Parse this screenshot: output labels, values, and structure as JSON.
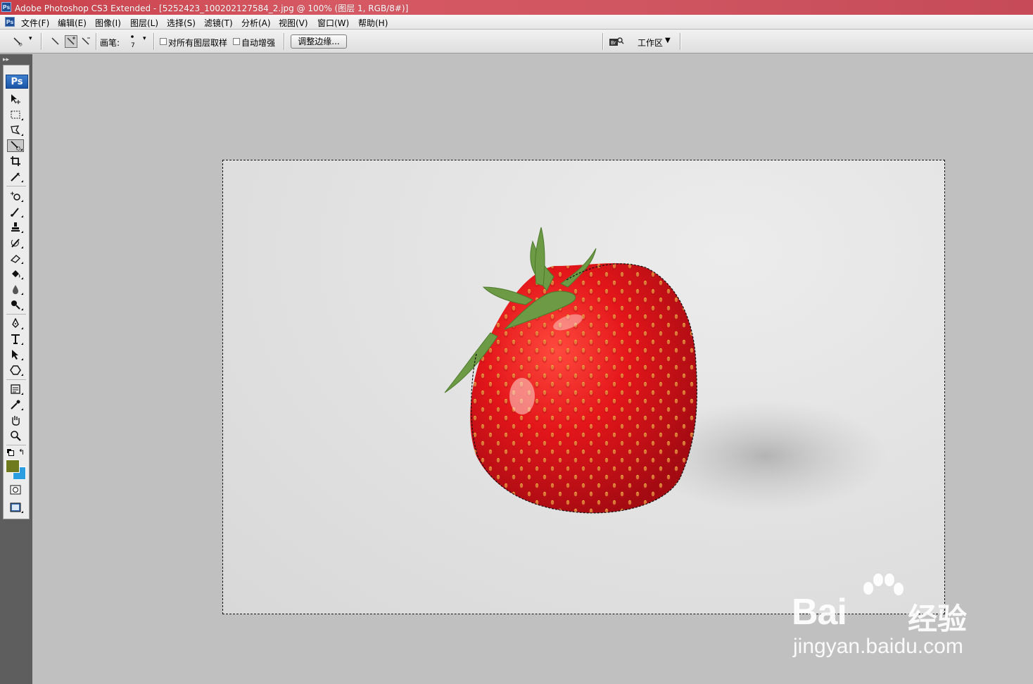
{
  "window": {
    "title": "Adobe Photoshop CS3 Extended - [5252423_100202127584_2.jpg @ 100% (图层 1, RGB/8#)]",
    "app_icon": "Ps"
  },
  "menu": {
    "items": [
      "文件(F)",
      "编辑(E)",
      "图像(I)",
      "图层(L)",
      "选择(S)",
      "滤镜(T)",
      "分析(A)",
      "视图(V)",
      "窗口(W)",
      "帮助(H)"
    ]
  },
  "options_bar": {
    "brush_label": "画笔:",
    "brush_size": "7",
    "sample_all_layers": "对所有图层取样",
    "sample_all_layers_checked": false,
    "auto_enhance": "自动增强",
    "auto_enhance_checked": false,
    "refine_edge": "调整边缘...",
    "workspace": "工作区",
    "active_mode": "add-to-selection"
  },
  "toolbox": {
    "badge": "Ps",
    "active_tool": "quick-selection",
    "foreground_color": "#6f7a1e",
    "background_color": "#2a9ee0"
  },
  "document": {
    "image_subject": "strawberry on white background",
    "selection": "active (marching ants around strawberry and canvas)"
  },
  "watermark": {
    "brand": "Bai",
    "brand_tail": "经验",
    "url": "jingyan.baidu.com"
  }
}
